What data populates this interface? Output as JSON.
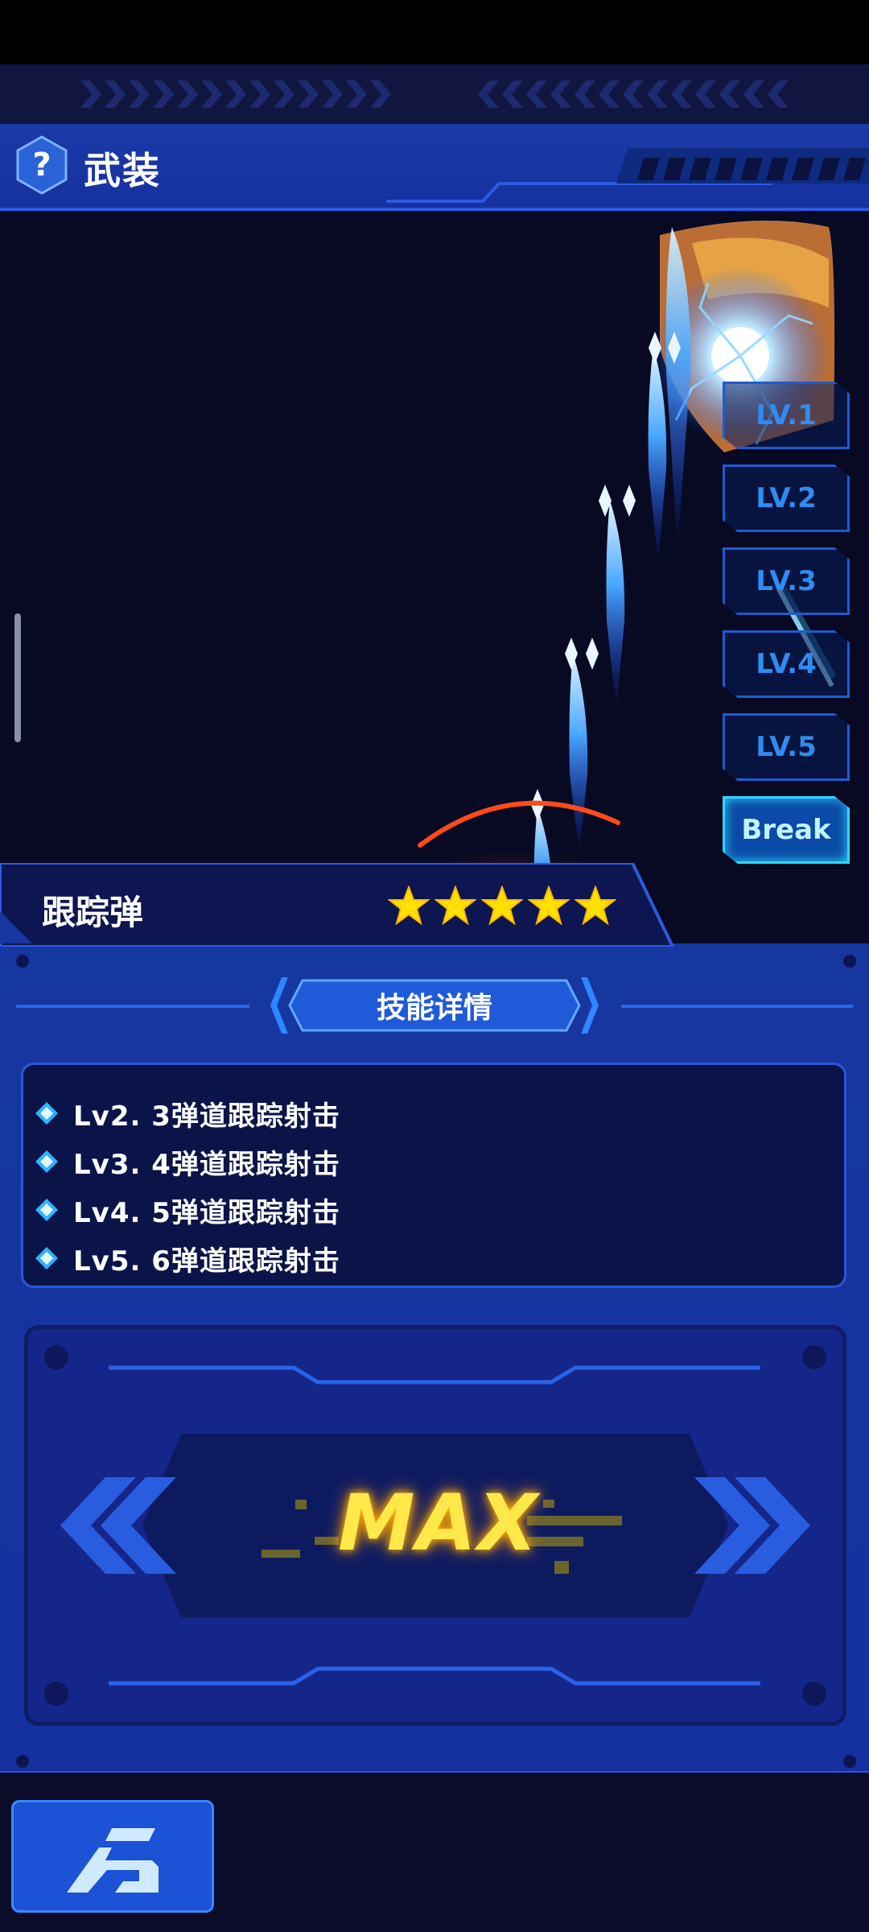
{
  "header": {
    "title": "武装",
    "help_icon": "question-hexagon-icon"
  },
  "preview": {
    "levels": [
      {
        "label": "LV.1",
        "active": false
      },
      {
        "label": "LV.2",
        "active": false
      },
      {
        "label": "LV.3",
        "active": false
      },
      {
        "label": "LV.4",
        "active": false
      },
      {
        "label": "LV.5",
        "active": false
      },
      {
        "label": "Break",
        "active": true
      }
    ]
  },
  "weapon": {
    "name": "跟踪弹",
    "stars": 5,
    "star_color": "#ffe000"
  },
  "details": {
    "section_title": "技能详情",
    "rows": [
      "Lv2. 3弹道跟踪射击",
      "Lv3. 4弹道跟踪射击",
      "Lv4. 5弹道跟踪射击",
      "Lv5. 6弹道跟踪射击"
    ]
  },
  "upgrade": {
    "status": "MAX"
  },
  "footer": {
    "back_icon": "back-arrow-icon"
  },
  "colors": {
    "panel_blue": "#1737a0",
    "accent_cyan": "#2fd6ff",
    "max_yellow": "#ffe84a"
  }
}
